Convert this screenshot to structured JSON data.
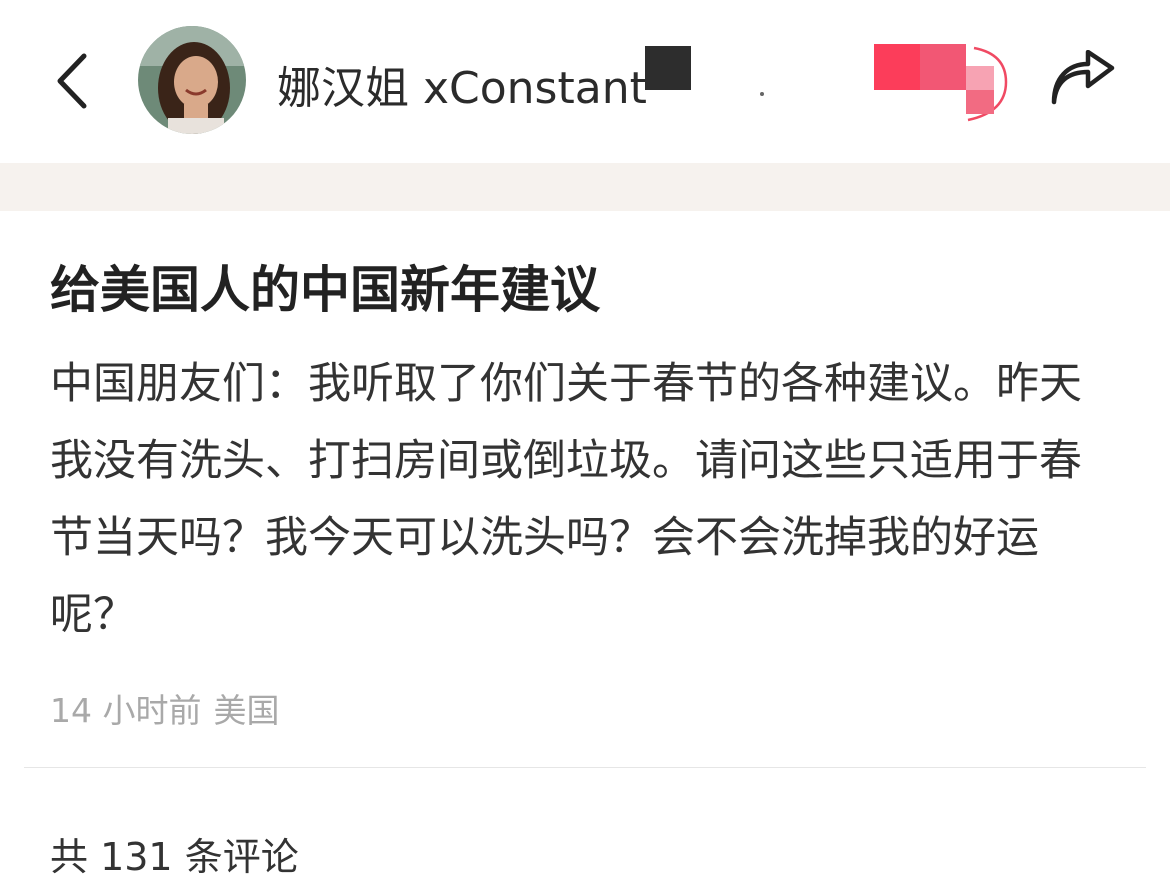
{
  "header": {
    "author_name": "娜汉姐 xConstant",
    "back_icon": "chevron-left-icon",
    "share_icon": "share-arrow-icon",
    "follow_button_colors": [
      "#fc3d5a",
      "#f26b82"
    ]
  },
  "post": {
    "title": "给美国人的中国新年建议",
    "body": "中国朋友们：我听取了你们关于春节的各种建议。昨天我没有洗头、打扫房间或倒垃圾。请问这些只适用于春节当天吗？我今天可以洗头吗？会不会洗掉我的好运呢？",
    "time": "14 小时前",
    "location": "美国"
  },
  "comments": {
    "label": "共 131 条评论"
  }
}
